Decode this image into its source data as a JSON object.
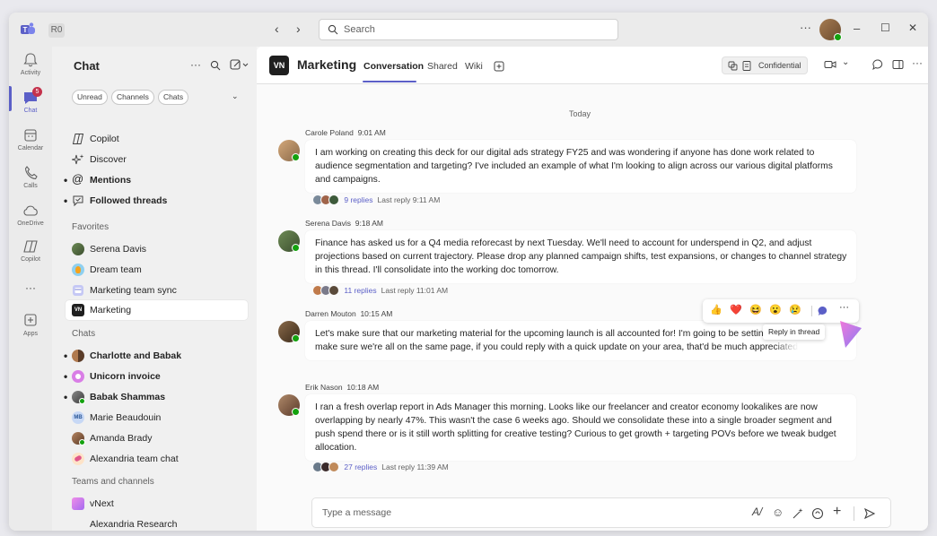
{
  "titlebar": {
    "user_initials": "R0",
    "search_placeholder": "Search",
    "more_label": "···",
    "minimize": "–",
    "maximize": "☐",
    "close": "✕"
  },
  "rail": {
    "items": [
      {
        "label": "Activity",
        "icon": "bell-icon"
      },
      {
        "label": "Chat",
        "icon": "chat-icon",
        "badge": "5"
      },
      {
        "label": "Calendar",
        "icon": "calendar-icon"
      },
      {
        "label": "Calls",
        "icon": "phone-icon"
      },
      {
        "label": "OneDrive",
        "icon": "cloud-icon"
      },
      {
        "label": "Copilot",
        "icon": "copilot-icon"
      },
      {
        "label": "Apps",
        "icon": "plus-icon"
      }
    ],
    "more_label": "···"
  },
  "chat_list": {
    "title": "Chat",
    "filters": [
      "Unread",
      "Channels",
      "Chats"
    ],
    "pinned": [
      {
        "label": "Copilot"
      },
      {
        "label": "Discover"
      },
      {
        "label": "Mentions"
      },
      {
        "label": "Followed threads"
      }
    ],
    "favorites_heading": "Favorites",
    "favorites": [
      {
        "label": "Serena Davis"
      },
      {
        "label": "Dream team"
      },
      {
        "label": "Marketing team sync"
      },
      {
        "label": "Marketing"
      }
    ],
    "chats_heading": "Chats",
    "chats": [
      {
        "label": "Charlotte and Babak"
      },
      {
        "label": "Unicorn invoice"
      },
      {
        "label": "Babak Shammas"
      },
      {
        "label": "Marie Beaudouin",
        "initials": "MB"
      },
      {
        "label": "Amanda Brady"
      },
      {
        "label": "Alexandria team chat"
      }
    ],
    "teams_heading": "Teams and channels",
    "teams": [
      {
        "label": "vNext"
      },
      {
        "label": "Alexandria Research"
      }
    ]
  },
  "channel": {
    "logo_text": "VN",
    "title": "Marketing",
    "tabs": [
      "Conversation",
      "Shared",
      "Wiki"
    ],
    "sensitivity": "Confidential"
  },
  "conversation": {
    "date_divider": "Today",
    "messages": [
      {
        "author": "Carole Poland",
        "time": "9:01 AM",
        "text": "I am working on creating this deck for our digital ads strategy FY25 and was wondering if anyone has done work related to audience segmentation and targeting? I've included an example of what I'm looking to align across our various digital platforms and campaigns.",
        "replies": "9 replies",
        "last_reply": "Last reply 9:11 AM"
      },
      {
        "author": "Serena Davis",
        "time": "9:18 AM",
        "text": "Finance has asked us for a Q4 media reforecast by next Tuesday. We'll need to account for underspend in Q2, and adjust projections based on current trajectory. Please drop any planned campaign shifts, test expansions, or changes to channel strategy in this thread. I'll consolidate into the working doc tomorrow.",
        "replies": "11 replies",
        "last_reply": "Last reply 11:01 AM"
      },
      {
        "author": "Darren Mouton",
        "time": "10:15 AM",
        "text": "Let's make sure that our marketing material for the upcoming launch is all accounted for! I'm going to be settin the stakeholders to make sure we're all on the same page, if you could reply with a quick update on your area, that'd be much appreciated.",
        "replies": "",
        "last_reply": ""
      },
      {
        "author": "Erik Nason",
        "time": "10:18 AM",
        "text": "I ran a fresh overlap report in Ads Manager this morning. Looks like our freelancer and creator economy lookalikes are now overlapping by nearly 47%. This wasn't the case 6 weeks ago. Should we consolidate these into a single broader segment and push spend there or is it still worth splitting for creative testing? Curious to get growth + targeting POVs before we tweak budget allocation.",
        "replies": "27 replies",
        "last_reply": "Last reply 11:39 AM"
      }
    ],
    "reactions": [
      "👍",
      "❤️",
      "😆",
      "😮",
      "😢"
    ],
    "tooltip": "Reply in thread"
  },
  "composer": {
    "placeholder": "Type a message"
  }
}
